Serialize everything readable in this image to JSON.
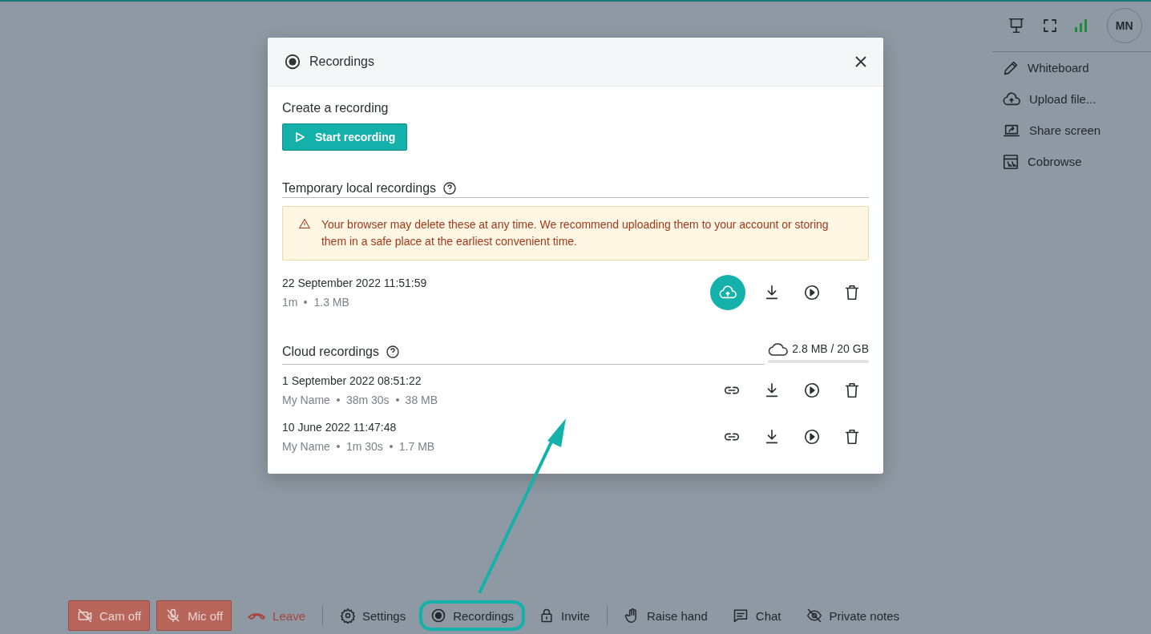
{
  "top_icons": [
    {
      "kind": "presenter"
    },
    {
      "kind": "fullscreen"
    },
    {
      "kind": "signal"
    }
  ],
  "avatar": {
    "initials": "MN"
  },
  "side_menu": [
    {
      "kind": "pencil",
      "label": "Whiteboard"
    },
    {
      "kind": "upload",
      "label": "Upload file..."
    },
    {
      "kind": "share",
      "label": "Share screen"
    },
    {
      "kind": "cobrowse",
      "label": "Cobrowse"
    }
  ],
  "dialog": {
    "title": "Recordings",
    "create_heading": "Create a recording",
    "start_button": "Start recording",
    "local_heading": "Temporary local recordings",
    "warning": "Your browser may delete these at any time. We recommend uploading them to your account or storing them in a safe place at the earliest convenient time.",
    "local_recordings": [
      {
        "date": "22 September 2022 11:51:59",
        "meta": [
          "1m",
          "1.3 MB"
        ]
      }
    ],
    "cloud_heading": "Cloud recordings",
    "storage": "2.8 MB / 20 GB",
    "cloud_recordings": [
      {
        "date": "1 September 2022 08:51:22",
        "meta": [
          "My Name",
          "38m 30s",
          "38 MB"
        ]
      },
      {
        "date": "10 June 2022 11:47:48",
        "meta": [
          "My Name",
          "1m 30s",
          "1.7 MB"
        ]
      }
    ]
  },
  "toolbar": [
    {
      "kind": "cam",
      "label": "Cam off",
      "highlighted": false
    },
    {
      "kind": "mic",
      "label": "Mic off",
      "highlighted": false
    },
    {
      "kind": "leave",
      "label": "Leave",
      "highlighted": false
    },
    {
      "kind": "divider"
    },
    {
      "kind": "gear",
      "label": "Settings",
      "highlighted": false
    },
    {
      "kind": "record",
      "label": "Recordings",
      "highlighted": true
    },
    {
      "kind": "lock",
      "label": "Invite",
      "highlighted": false
    },
    {
      "kind": "divider"
    },
    {
      "kind": "hand",
      "label": "Raise hand",
      "highlighted": false
    },
    {
      "kind": "chat",
      "label": "Chat",
      "highlighted": false
    },
    {
      "kind": "eye",
      "label": "Private notes",
      "highlighted": false
    }
  ]
}
